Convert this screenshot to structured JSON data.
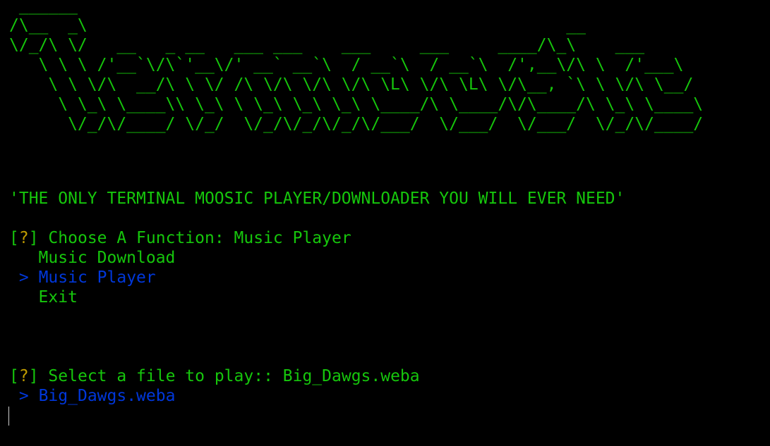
{
  "banner_ascii": " ______\n/\\__  _\\                                                 __\n\\/_/\\ \\/   __   _ __   ___ ___    ___     ___     ____/\\_\\    ___\n   \\ \\ \\ /'__`\\/\\`'__\\/' __` __`\\  / __`\\  / __`\\  /',__\\/\\ \\  /'___\\\n    \\ \\ \\/\\  __/\\ \\ \\/ /\\ \\/\\ \\/\\ \\/\\ \\L\\ \\/\\ \\L\\ \\/\\__, `\\ \\ \\/\\ \\__/\n     \\ \\_\\ \\____\\\\ \\_\\ \\ \\_\\ \\_\\ \\_\\ \\____/\\ \\____/\\/\\____/\\ \\_\\ \\____\\\n      \\/_/\\/____/ \\/_/  \\/_/\\/_/\\/_/\\/___/  \\/___/  \\/___/  \\/_/\\/____/",
  "tagline": "'THE ONLY TERMINAL MOOSIC PLAYER/DOWNLOADER YOU WILL EVER NEED'",
  "function_prompt": {
    "bracket_open": "[",
    "mark": "?",
    "bracket_close": "]",
    "question": " Choose A Function: ",
    "answer": "Music Player",
    "options": [
      "Music Download",
      "Music Player",
      "Exit"
    ],
    "selected_index": 1,
    "pointer": ">"
  },
  "file_prompt": {
    "bracket_open": "[",
    "mark": "?",
    "bracket_close": "]",
    "question": " Select a file to play:: ",
    "answer": "Big_Dawgs.weba",
    "options": [
      "Big_Dawgs.weba"
    ],
    "selected_index": 0,
    "pointer": ">"
  },
  "colors": {
    "background": "#000000",
    "text_green": "#16c60c",
    "question_mark": "#c19c00",
    "selected_blue": "#0037da",
    "cursor": "#cccccc"
  }
}
